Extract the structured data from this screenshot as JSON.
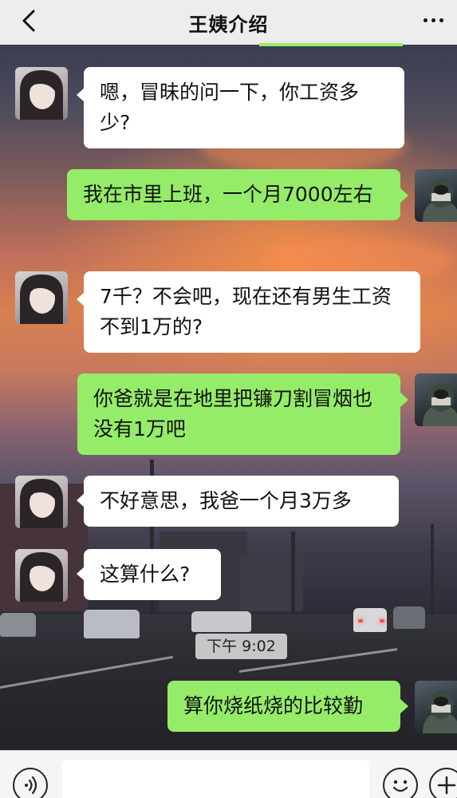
{
  "header": {
    "title": "王姨介绍",
    "back_icon": "chevron-left-icon",
    "more_icon": "more-dots-icon"
  },
  "messages": [
    {
      "side": "left",
      "sender": "contact",
      "text": "嗯，冒昧的问一下，你工资多少?"
    },
    {
      "side": "right",
      "sender": "me",
      "text": "我在市里上班，一个月7000左右"
    },
    {
      "side": "left",
      "sender": "contact",
      "text": "7千？不会吧，现在还有男生工资不到1万的?"
    },
    {
      "side": "right",
      "sender": "me",
      "text": "你爸就是在地里把镰刀割冒烟也没有1万吧"
    },
    {
      "side": "left",
      "sender": "contact",
      "text": "不好意思，我爸一个月3万多"
    },
    {
      "side": "left",
      "sender": "contact",
      "text": "这算什么?"
    },
    {
      "side": "right",
      "sender": "me",
      "text": "算你烧纸烧的比较勤"
    }
  ],
  "timestamp": "下午 9:02",
  "input_bar": {
    "voice_icon": "voice-icon",
    "emoji_icon": "emoji-icon",
    "plus_icon": "plus-icon",
    "placeholder": ""
  },
  "colors": {
    "my_bubble": "#95ec69",
    "their_bubble": "#ffffff",
    "header_bg": "#ededed"
  }
}
